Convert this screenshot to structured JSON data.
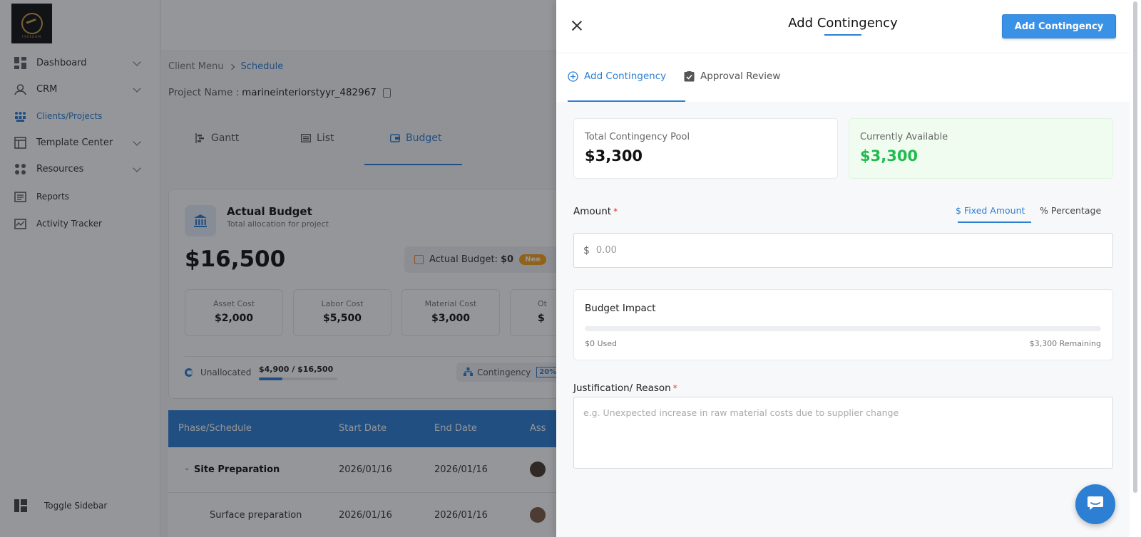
{
  "sidebar": {
    "logo_text": "FREEDOM",
    "items": [
      {
        "label": "Dashboard",
        "icon": "dashboard-icon",
        "has_chevron": true
      },
      {
        "label": "CRM",
        "icon": "crm-icon",
        "has_chevron": true
      },
      {
        "label": "Clients/Projects",
        "icon": "users-icon",
        "has_chevron": false,
        "active": true
      },
      {
        "label": "Template Center",
        "icon": "template-icon",
        "has_chevron": true
      },
      {
        "label": "Resources",
        "icon": "resources-icon",
        "has_chevron": true
      },
      {
        "label": "Reports",
        "icon": "reports-icon",
        "has_chevron": false
      },
      {
        "label": "Activity Tracker",
        "icon": "activity-icon",
        "has_chevron": false
      }
    ],
    "toggle_label": "Toggle Sidebar"
  },
  "main": {
    "breadcrumb": {
      "root": "Client Menu",
      "current": "Schedule"
    },
    "project_label": "Project Name :",
    "project_name": "marineinteriorstyyr_482967",
    "view_tabs": [
      {
        "label": "Gantt"
      },
      {
        "label": "List"
      },
      {
        "label": "Budget",
        "active": true
      }
    ],
    "budget_card": {
      "title": "Actual Budget",
      "subtitle": "Total allocation for project",
      "amount": "$16,500",
      "actual_label": "Actual Budget:",
      "actual_value": "$0",
      "actual_pill": "Nee",
      "costs": [
        {
          "label": "Asset Cost",
          "value": "$2,000"
        },
        {
          "label": "Labor Cost",
          "value": "$5,500"
        },
        {
          "label": "Material Cost",
          "value": "$3,000"
        },
        {
          "label": "Ot",
          "value": "$"
        }
      ],
      "unallocated_label": "Unallocated",
      "ratio": "$4,900 / $16,500",
      "ratio_fraction": 0.297,
      "contingency_label": "Contingency",
      "contingency_pct": "20%"
    },
    "table": {
      "headers": [
        "Phase/Schedule",
        "Start Date",
        "End Date",
        "Ass"
      ],
      "rows": [
        {
          "name": "Site Preparation",
          "start": "2026/01/16",
          "end": "2026/01/16",
          "bold": true
        },
        {
          "name": "Surface preparation",
          "start": "2026/01/16",
          "end": "2026/01/16",
          "bold": false
        }
      ]
    }
  },
  "drawer": {
    "title": "Add Contingency",
    "primary_button": "Add Contingency",
    "tabs": [
      {
        "label": "Add Contingency",
        "icon": "plus-circle-icon",
        "active": true
      },
      {
        "label": "Approval Review",
        "icon": "checkbox-icon",
        "active": false
      }
    ],
    "stats": {
      "pool_label": "Total Contingency Pool",
      "pool_value": "$3,300",
      "available_label": "Currently Available",
      "available_value": "$3,300"
    },
    "amount": {
      "label": "Amount",
      "required_mark": "*",
      "mode_fixed": "$ Fixed Amount",
      "mode_percentage": "% Percentage",
      "currency": "$",
      "value": "",
      "placeholder": "0.00"
    },
    "impact": {
      "title": "Budget Impact",
      "used": "$0 Used",
      "remaining": "$3,300 Remaining",
      "used_fraction": 0
    },
    "justification": {
      "label": "Justification/ Reason",
      "required_mark": "*",
      "value": "",
      "placeholder": "e.g. Unexpected increase in raw material costs due to supplier change"
    }
  },
  "colors": {
    "accent": "#2d7fd3",
    "primary_button": "#3a92e6",
    "available_green": "#1fbb4e",
    "required_red": "#e03131"
  }
}
